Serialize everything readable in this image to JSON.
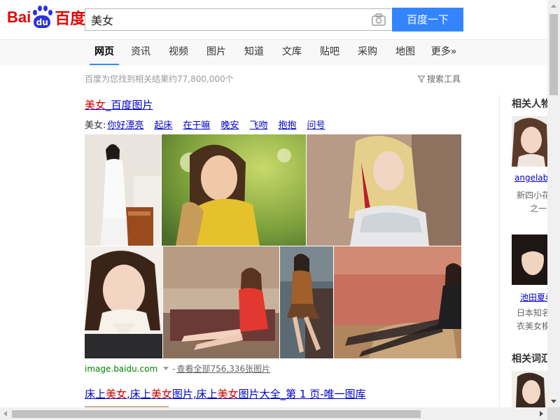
{
  "header": {
    "logo": {
      "latin_left": "Bai",
      "paw_text": "du",
      "chinese": "百度"
    },
    "search": {
      "value": "美女"
    },
    "search_button_label": "百度一下"
  },
  "tabs": [
    {
      "label": "网页",
      "active": true
    },
    {
      "label": "资讯"
    },
    {
      "label": "视频"
    },
    {
      "label": "图片"
    },
    {
      "label": "知道"
    },
    {
      "label": "文库"
    },
    {
      "label": "贴吧"
    },
    {
      "label": "采购"
    },
    {
      "label": "地图"
    },
    {
      "label": "更多»"
    }
  ],
  "result_count": "百度为您找到相关结果约77,800,000个",
  "search_tools_label": "搜索工具",
  "result1": {
    "title_highlight": "美女",
    "title_rest": "_百度图片",
    "related_label": "美女:",
    "related_terms": [
      "你好漂亮",
      "起床",
      "在干嘛",
      "晚安",
      "飞吻",
      "抱抱",
      "问号"
    ],
    "source_url": "image.baidu.com",
    "separator": "-",
    "view_all": "查看全部756,336张图片"
  },
  "result2": {
    "title_parts": [
      {
        "text": "床上",
        "hl": false
      },
      {
        "text": "美女",
        "hl": true
      },
      {
        "text": ",床上",
        "hl": false
      },
      {
        "text": "美女",
        "hl": true
      },
      {
        "text": "图片,床上",
        "hl": false
      },
      {
        "text": "美女",
        "hl": true
      },
      {
        "text": "图片大全_第 1 页-唯一图库",
        "hl": false
      }
    ]
  },
  "sidebar": {
    "people_heading": "相关人物",
    "person1": {
      "name": "angelababy",
      "desc_line1": "新四小花",
      "desc_line2": "之一"
    },
    "person2": {
      "name": "池田夏希",
      "desc_line1": "日本知名",
      "desc_line2": "衣美女模"
    },
    "terms_heading": "相关词汇"
  },
  "colors": {
    "accent": "#3385ff",
    "link": "#0000cc",
    "highlight": "#cc0000",
    "url_green": "#008000"
  }
}
